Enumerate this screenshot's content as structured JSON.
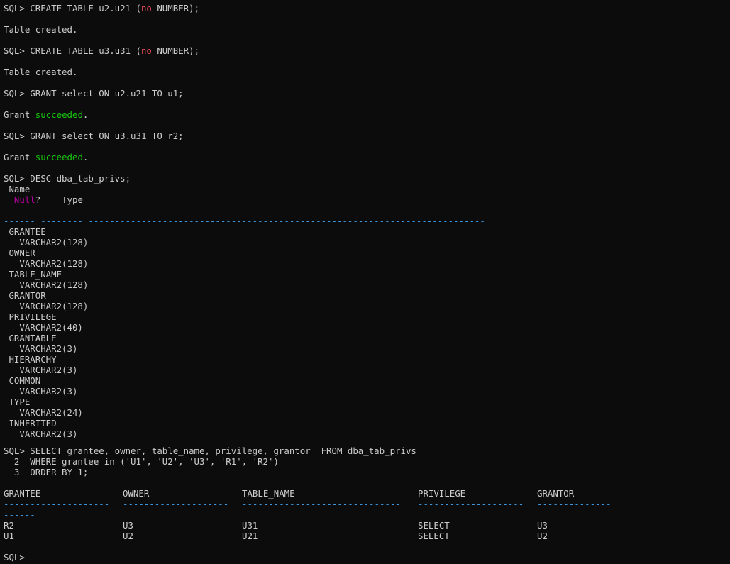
{
  "terminal": {
    "colors": {
      "background": "#0c0c0c",
      "text": "#cccccc",
      "keyword": "#e74856",
      "success": "#16c60c",
      "null_label": "#b4009e",
      "dash_rule": "#3a96dd"
    },
    "prompt": "SQL> ",
    "create_u2": {
      "prefix": "SQL> CREATE TABLE u2.u21 (",
      "kw": "no",
      "suffix": " NUMBER);"
    },
    "create_u2_result": "Table created.",
    "create_u3": {
      "prefix": "SQL> CREATE TABLE u3.u31 (",
      "kw": "no",
      "suffix": " NUMBER);"
    },
    "create_u3_result": "Table created.",
    "grant_u1": "SQL> GRANT select ON u2.u21 TO u1;",
    "grant_u1_result": {
      "prefix": "Grant ",
      "word": "succeeded",
      "suffix": "."
    },
    "grant_r2": "SQL> GRANT select ON u3.u31 TO r2;",
    "grant_r2_result": {
      "prefix": "Grant ",
      "word": "succeeded",
      "suffix": "."
    },
    "desc_command": "SQL> DESC dba_tab_privs;",
    "desc_header": {
      "name": " Name",
      "null_label": "Null",
      "null_suffix": "?    Type"
    },
    "desc_rule_1": "------------------------------------------------------------------------------------------------------------",
    "desc_rule_2": "------ -------- ---------------------------------------------------------------------------",
    "desc_columns": [
      {
        "name": " GRANTEE",
        "type": "   VARCHAR2(128)"
      },
      {
        "name": " OWNER",
        "type": "   VARCHAR2(128)"
      },
      {
        "name": " TABLE_NAME",
        "type": "   VARCHAR2(128)"
      },
      {
        "name": " GRANTOR",
        "type": "   VARCHAR2(128)"
      },
      {
        "name": " PRIVILEGE",
        "type": "   VARCHAR2(40)"
      },
      {
        "name": " GRANTABLE",
        "type": "   VARCHAR2(3)"
      },
      {
        "name": " HIERARCHY",
        "type": "   VARCHAR2(3)"
      },
      {
        "name": " COMMON",
        "type": "   VARCHAR2(3)"
      },
      {
        "name": " TYPE",
        "type": "   VARCHAR2(24)"
      },
      {
        "name": " INHERITED",
        "type": "   VARCHAR2(3)"
      }
    ],
    "select_lines": [
      "SQL> SELECT grantee, owner, table_name, privilege, grantor  FROM dba_tab_privs",
      "  2  WHERE grantee in ('U1', 'U2', 'U3', 'R1', 'R2')",
      "  3  ORDER BY 1;"
    ],
    "report": {
      "headers": [
        "GRANTEE",
        "OWNER",
        "TABLE_NAME",
        "PRIVILEGE",
        "GRANTOR"
      ],
      "rules": [
        "--------------------",
        "--------------------",
        "------------------------------",
        "--------------------",
        "--------------"
      ],
      "rule_wrap": "------",
      "rows": [
        [
          "R2",
          "U3",
          "U31",
          "SELECT",
          "U3"
        ],
        [
          "U1",
          "U2",
          "U21",
          "SELECT",
          "U2"
        ]
      ]
    },
    "final_prompt": "SQL>"
  }
}
